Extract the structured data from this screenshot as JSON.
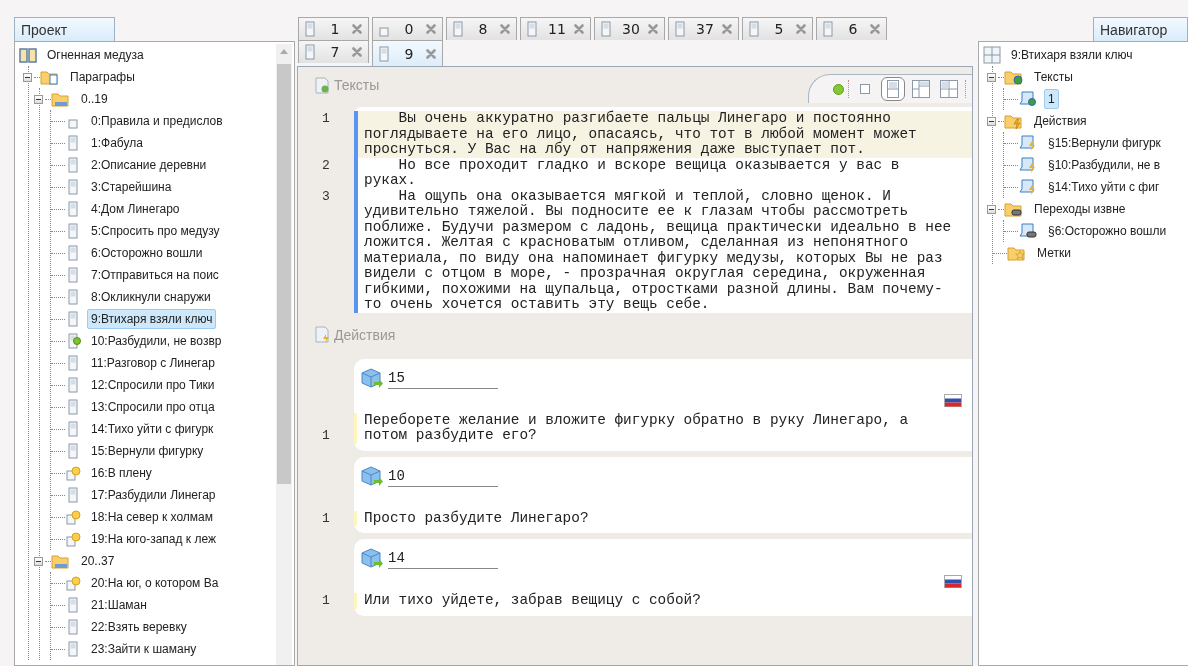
{
  "project_panel": {
    "title": "Проект",
    "tree": [
      {
        "label": "Огненная медуза",
        "kind": "book",
        "selected": false,
        "children": [
          {
            "label": "Параграфы",
            "kind": "docfolder",
            "selected": false,
            "expanded": true,
            "children": [
              {
                "label": "0..19",
                "kind": "folder",
                "selected": false,
                "expanded": true,
                "children": [
                  {
                    "label": "0:Правила и предислов",
                    "kind": "stub",
                    "selected": false
                  },
                  {
                    "label": "1:Фабула",
                    "kind": "page",
                    "selected": false
                  },
                  {
                    "label": "2:Описание деревни",
                    "kind": "page",
                    "selected": false
                  },
                  {
                    "label": "3:Старейшина",
                    "kind": "page",
                    "selected": false
                  },
                  {
                    "label": "4:Дом Линегаро",
                    "kind": "page",
                    "selected": false
                  },
                  {
                    "label": "5:Спросить про медузу",
                    "kind": "page",
                    "selected": false
                  },
                  {
                    "label": "6:Осторожно вошли",
                    "kind": "page",
                    "selected": false
                  },
                  {
                    "label": "7:Отправиться на поис",
                    "kind": "page",
                    "selected": false
                  },
                  {
                    "label": "8:Окликнули снаружи",
                    "kind": "page",
                    "selected": false
                  },
                  {
                    "label": "9:Втихаря взяли ключ",
                    "kind": "page",
                    "selected": true
                  },
                  {
                    "label": "10:Разбудили, не возвр",
                    "kind": "green",
                    "selected": false
                  },
                  {
                    "label": "11:Разговор с Линегар",
                    "kind": "page",
                    "selected": false
                  },
                  {
                    "label": "12:Спросили про Тики",
                    "kind": "page",
                    "selected": false
                  },
                  {
                    "label": "13:Спросили про отца",
                    "kind": "page",
                    "selected": false
                  },
                  {
                    "label": "14:Тихо уйти с фигурк",
                    "kind": "page",
                    "selected": false
                  },
                  {
                    "label": "15:Вернули фигурку",
                    "kind": "page",
                    "selected": false
                  },
                  {
                    "label": "16:В плену",
                    "kind": "yellow",
                    "selected": false
                  },
                  {
                    "label": "17:Разбудили Линегар",
                    "kind": "page",
                    "selected": false
                  },
                  {
                    "label": "18:На север к холмам",
                    "kind": "yellow",
                    "selected": false
                  },
                  {
                    "label": "19:На юго-запад к леж",
                    "kind": "yellow",
                    "selected": false
                  }
                ]
              },
              {
                "label": "20..37",
                "kind": "folder",
                "selected": false,
                "expanded": true,
                "children": [
                  {
                    "label": "20:На юг, о котором Ва",
                    "kind": "yellow",
                    "selected": false
                  },
                  {
                    "label": "21:Шаман",
                    "kind": "page",
                    "selected": false
                  },
                  {
                    "label": "22:Взять веревку",
                    "kind": "page",
                    "selected": false
                  },
                  {
                    "label": "23:Зайти к шаману",
                    "kind": "page",
                    "selected": false
                  }
                ]
              }
            ]
          }
        ]
      }
    ]
  },
  "tabs": [
    {
      "label": "1",
      "kind": "page",
      "selected": false
    },
    {
      "label": "0",
      "kind": "stub",
      "selected": false
    },
    {
      "label": "8",
      "kind": "page",
      "selected": false
    },
    {
      "label": "11",
      "kind": "page",
      "selected": false
    },
    {
      "label": "30",
      "kind": "page",
      "selected": false
    },
    {
      "label": "37",
      "kind": "page",
      "selected": false
    },
    {
      "label": "5",
      "kind": "page",
      "selected": false
    },
    {
      "label": "6",
      "kind": "page",
      "selected": false
    },
    {
      "label": "7",
      "kind": "page",
      "selected": false
    },
    {
      "label": "9",
      "kind": "page",
      "selected": true
    }
  ],
  "texts_section": {
    "title": "Тексты",
    "layouts": [
      {
        "kind": "single",
        "selected": false
      },
      {
        "kind": "double",
        "selected": true
      },
      {
        "kind": "triple",
        "selected": false
      },
      {
        "kind": "quad",
        "selected": false
      }
    ],
    "lines": [
      {
        "number": "1",
        "current": true,
        "text": "    Вы очень аккуратно разгибаете пальцы Линегаро и постоянно поглядываете на его лицо, опасаясь, что тот в любой момент может проснуться. У Вас на лбу от напряжения даже выступает пот."
      },
      {
        "number": "2",
        "current": false,
        "text": "    Но все проходит гладко и вскоре вещица оказывается у вас в руках."
      },
      {
        "number": "3",
        "current": false,
        "text": "    На ощупь она оказывается мягкой и теплой, словно щенок. И удивительно тяжелой. Вы подносите ее к глазам чтобы рассмотреть поближе. Будучи размером с ладонь, вещица практически идеально в нее ложится. Желтая с красноватым отливом, сделанная из непонятного материала, по виду она напоминает фигурку медузы, которых Вы не раз видели с отцом в море, - прозрачная округлая середина, окруженная гибкими, похожими на щупальца, отростками разной длины. Вам почему-то очень хочется оставить эту вещь себе."
      }
    ]
  },
  "actions_section": {
    "title": "Действия",
    "actions": [
      {
        "target": "15",
        "flag": true,
        "line": "1",
        "text": "Переборете желание и вложите фигурку обратно в руку Линегаро, а потом разбудите его?"
      },
      {
        "target": "10",
        "flag": false,
        "line": "1",
        "text": "Просто разбудите Линегаро?"
      },
      {
        "target": "14",
        "flag": true,
        "line": "1",
        "text": "Или тихо уйдете, забрав вещицу с собой?"
      }
    ]
  },
  "navigator": {
    "title": "Навигатор",
    "tree": [
      {
        "label": "9:Втихаря взяли ключ",
        "kind": "grid",
        "selected": false,
        "children": [
          {
            "label": "Тексты",
            "kind": "texts",
            "selected": false,
            "expanded": true,
            "children": [
              {
                "label": "1",
                "kind": "text",
                "selected": true
              }
            ]
          },
          {
            "label": "Действия",
            "kind": "actions",
            "selected": false,
            "expanded": true,
            "children": [
              {
                "label": "§15:Вернули фигурк",
                "kind": "action",
                "selected": false
              },
              {
                "label": "§10:Разбудили, не в",
                "kind": "action",
                "selected": false
              },
              {
                "label": "§14:Тихо уйти с фиг",
                "kind": "action",
                "selected": false
              }
            ]
          },
          {
            "label": "Переходы извне",
            "kind": "links",
            "selected": false,
            "expanded": true,
            "children": [
              {
                "label": "§6:Осторожно вошли",
                "kind": "link",
                "selected": false
              }
            ]
          },
          {
            "label": "Метки",
            "kind": "tags",
            "selected": false
          }
        ]
      }
    ]
  }
}
